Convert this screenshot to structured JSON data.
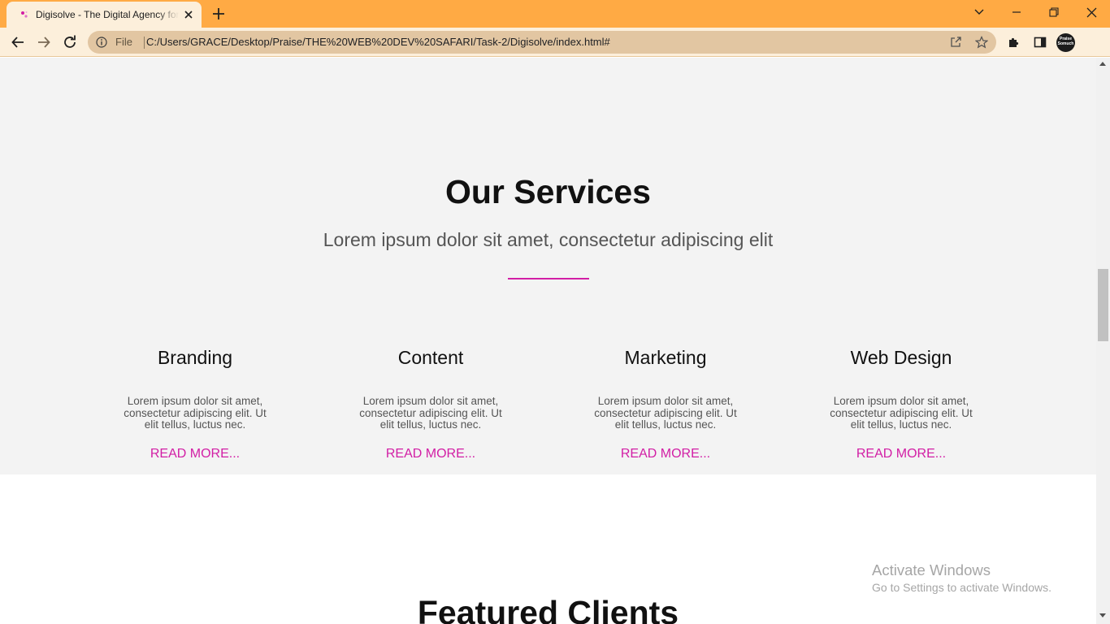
{
  "browser": {
    "tab": {
      "title": "Digisolve - The Digital Agency for Creative Minds",
      "favicon": "sparkle-favicon-icon",
      "close_icon": "close-icon"
    },
    "new_tab_icon": "plus-icon",
    "window_controls": [
      "chevron-down-icon",
      "minimize-icon",
      "restore-icon",
      "close-icon"
    ],
    "nav_icons": [
      "back-arrow-icon",
      "forward-arrow-icon",
      "reload-icon"
    ],
    "address_bar": {
      "scheme_label": "File",
      "url": "C:/Users/GRACE/Desktop/Praise/THE%20WEB%20DEV%20SAFARI/Task-2/Digisolve/index.html#",
      "icons": [
        "info-icon",
        "share-icon",
        "bookmark-star-icon"
      ]
    },
    "toolbar_icons": [
      "extensions-puzzle-icon",
      "side-panel-icon"
    ],
    "profile_avatar_text": "Praise Somuch",
    "colors": {
      "tabstrip": "#ffaa44",
      "toolbar": "#fcefdb",
      "omnibox": "#e2c6a2"
    }
  },
  "page": {
    "services": {
      "title": "Our Services",
      "subtitle": "Lorem ipsum dolor sit amet, consectetur adipiscing elit",
      "cards": [
        {
          "title": "Branding",
          "text": "Lorem ipsum dolor sit amet, consectetur adipiscing elit. Ut elit tellus, luctus nec.",
          "link": "READ MORE..."
        },
        {
          "title": "Content",
          "text": "Lorem ipsum dolor sit amet, consectetur adipiscing elit. Ut elit tellus, luctus nec.",
          "link": "READ MORE..."
        },
        {
          "title": "Marketing",
          "text": "Lorem ipsum dolor sit amet, consectetur adipiscing elit. Ut elit tellus, luctus nec.",
          "link": "READ MORE..."
        },
        {
          "title": "Web Design",
          "text": "Lorem ipsum dolor sit amet, consectetur adipiscing elit. Ut elit tellus, luctus nec.",
          "link": "READ MORE..."
        }
      ]
    },
    "clients": {
      "title": "Featured Clients"
    },
    "colors": {
      "accent": "#d21ea5",
      "section_bg": "#f3f3f3"
    }
  },
  "overlay": {
    "activate_title": "Activate Windows",
    "activate_subtitle": "Go to Settings to activate Windows."
  }
}
